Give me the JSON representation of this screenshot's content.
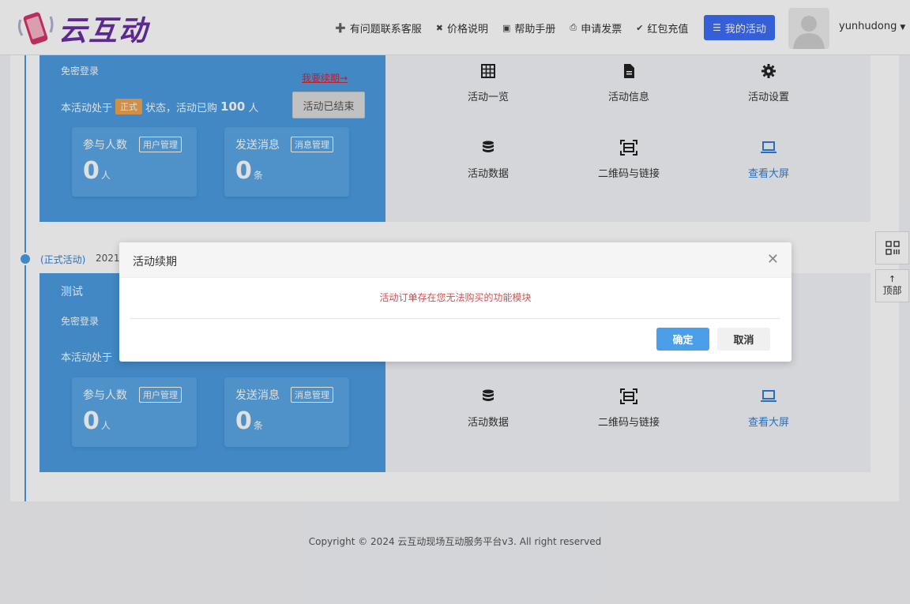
{
  "brand": {
    "name": "云互动"
  },
  "nav": {
    "items": [
      {
        "icon": "user-plus-icon",
        "label": "有问题联系客服"
      },
      {
        "icon": "tag-icon",
        "label": "价格说明"
      },
      {
        "icon": "book-icon",
        "label": "帮助手册"
      },
      {
        "icon": "print-icon",
        "label": "申请发票"
      },
      {
        "icon": "shield-check-icon",
        "label": "红包充值"
      }
    ],
    "my_activity": "我的活动",
    "username": "yunhudong"
  },
  "cards": [
    {
      "title": "",
      "subtitle": "免密登录",
      "renew_link": "我要续期→",
      "status_prefix": "本活动处于",
      "status_tag": "正式",
      "status_mid": "状态，活动已购",
      "status_count": "100",
      "status_suffix": "人",
      "ended_button": "活动已结束",
      "participants_label": "参与人数",
      "participants_btn": "用户管理",
      "participants_num": "0",
      "participants_unit": "人",
      "messages_label": "发送消息",
      "messages_btn": "消息管理",
      "messages_num": "0",
      "messages_unit": "条",
      "functions": [
        {
          "icon": "grid-icon",
          "label": "活动一览"
        },
        {
          "icon": "document-icon",
          "label": "活动信息"
        },
        {
          "icon": "gear-icon",
          "label": "活动设置"
        },
        {
          "icon": "database-icon",
          "label": "活动数据"
        },
        {
          "icon": "qrcode-icon",
          "label": "二维码与链接"
        },
        {
          "icon": "laptop-icon",
          "label": "查看大屏"
        }
      ]
    },
    {
      "timeline_label": "(正式活动)",
      "timeline_date": "2021-",
      "title": "测试",
      "subtitle": "免密登录",
      "status_prefix": "本活动处于",
      "participants_label": "参与人数",
      "participants_btn": "用户管理",
      "participants_num": "0",
      "participants_unit": "人",
      "messages_label": "发送消息",
      "messages_btn": "消息管理",
      "messages_num": "0",
      "messages_unit": "条",
      "functions": [
        {
          "icon": "database-icon",
          "label": "活动数据"
        },
        {
          "icon": "qrcode-icon",
          "label": "二维码与链接"
        },
        {
          "icon": "laptop-icon",
          "label": "查看大屏"
        }
      ]
    }
  ],
  "side": {
    "top_label": "顶部"
  },
  "dialog": {
    "title": "活动续期",
    "message": "活动订单存在您无法购买的功能模块",
    "ok": "确定",
    "cancel": "取消"
  },
  "footer": {
    "text": "Copyright © 2024 云互动现场互动服务平台v3. All right reserved"
  },
  "colors": {
    "accent": "#4a9be0",
    "nav_button": "#3d6df5",
    "tag": "#f0a24a",
    "danger": "#e04a4a",
    "logo": "#6a2fa6"
  }
}
